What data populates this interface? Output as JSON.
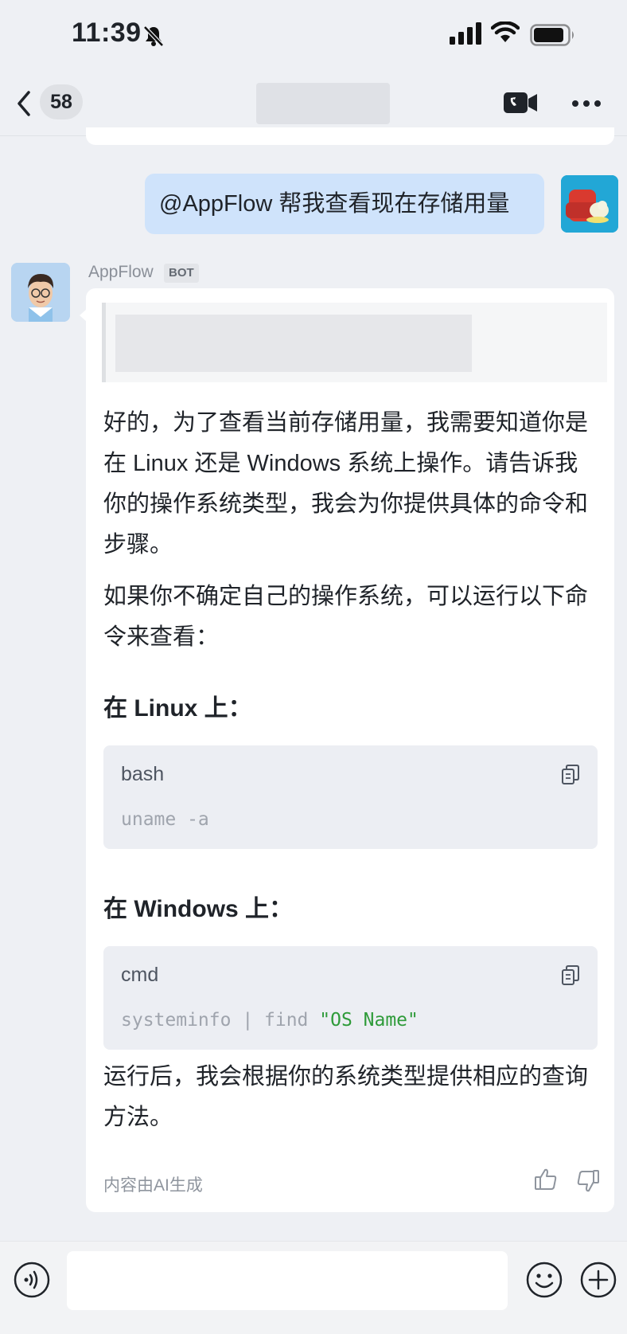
{
  "status_bar": {
    "time": "11:39",
    "icons": [
      "bell-slash-icon",
      "signal-icon",
      "wifi-icon",
      "battery-icon"
    ]
  },
  "nav": {
    "back_icon": "chevron-left-icon",
    "unread_count": "58",
    "title": "",
    "video_call_icon": "video-camera-icon",
    "more_icon": "ellipsis-icon"
  },
  "user_message": {
    "text": "@AppFlow 帮我查看现在存储用量"
  },
  "bot_message": {
    "sender_name": "AppFlow",
    "badge": "BOT",
    "quote_text": "",
    "paragraph_1": "好的，为了查看当前存储用量，我需要知道你是在 Linux 还是 Windows 系统上操作。请告诉我你的操作系统类型，我会为你提供具体的命令和步骤。",
    "paragraph_2": "如果你不确定自己的操作系统，可以运行以下命令来查看：",
    "heading_linux": "在 Linux 上：",
    "code_linux": {
      "language": "bash",
      "code": "uname -a"
    },
    "heading_windows": "在 Windows 上：",
    "code_windows": {
      "language": "cmd",
      "code_prefix": "systeminfo | find ",
      "code_string": "\"OS Name\""
    },
    "paragraph_3": "运行后，我会根据你的系统类型提供相应的查询方法。",
    "ai_notice": "内容由AI生成"
  },
  "input_bar": {
    "placeholder": "",
    "icons": [
      "voice-icon",
      "emoji-icon",
      "plus-icon"
    ]
  },
  "colors": {
    "background": "#eef0f4",
    "user_bubble": "#cfe3fb",
    "card": "#ffffff",
    "code_bg": "#eceef3",
    "code_string": "#2f9b3a"
  }
}
